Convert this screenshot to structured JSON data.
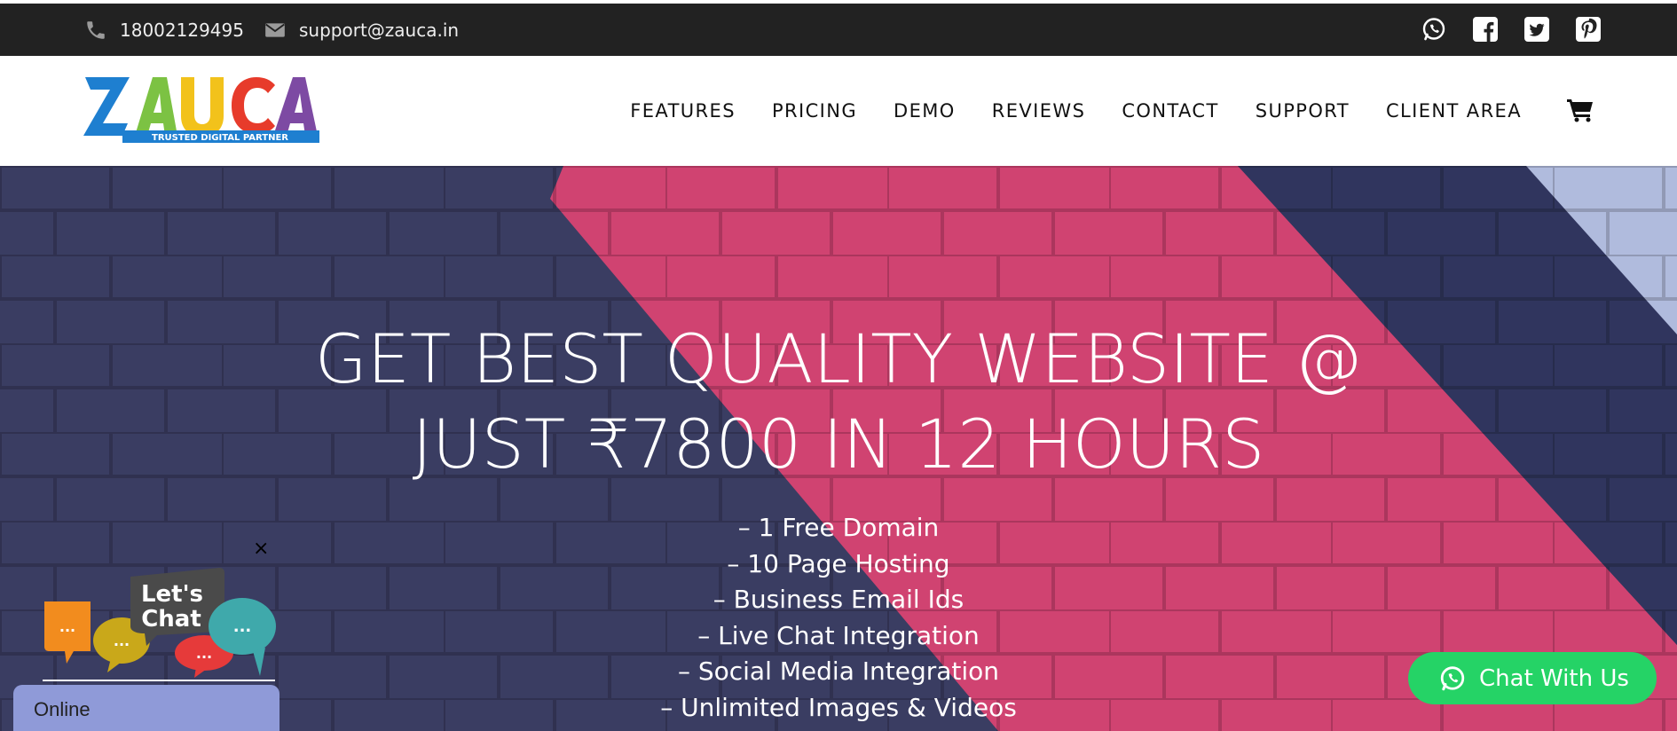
{
  "topbar": {
    "phone": "18002129495",
    "email": "support@zauca.in",
    "phone_icon": "phone-icon",
    "email_icon": "envelope-icon",
    "socials": [
      "whatsapp-icon",
      "facebook-icon",
      "twitter-icon",
      "pinterest-icon"
    ]
  },
  "header": {
    "logo_text": "ZAUCA",
    "logo_tagline": "TRUSTED DIGITAL PARTNER",
    "nav": [
      "FEATURES",
      "PRICING",
      "DEMO",
      "REVIEWS",
      "CONTACT",
      "SUPPORT",
      "CLIENT AREA"
    ],
    "cart_icon": "shopping-cart-icon"
  },
  "hero": {
    "title_line1": "GET BEST QUALITY WEBSITE @",
    "title_line2": "JUST ₹7800 IN 12 HOURS",
    "features": [
      "– 1 Free Domain",
      "– 10 Page Hosting",
      "– Business Email Ids",
      "– Live Chat Integration",
      "– Social Media Integration",
      "– Unlimited Images & Videos"
    ]
  },
  "chat": {
    "lets_chat_line1": "Let's",
    "lets_chat_line2": "Chat",
    "close": "×",
    "online_label": "Online",
    "whatsapp_label": "Chat With Us"
  },
  "colors": {
    "topbar_bg": "#222222",
    "hero_navy": "#3d4066",
    "hero_pink": "#d94676",
    "whatsapp_green": "#25d366",
    "online_bg": "#8f9ad8"
  }
}
